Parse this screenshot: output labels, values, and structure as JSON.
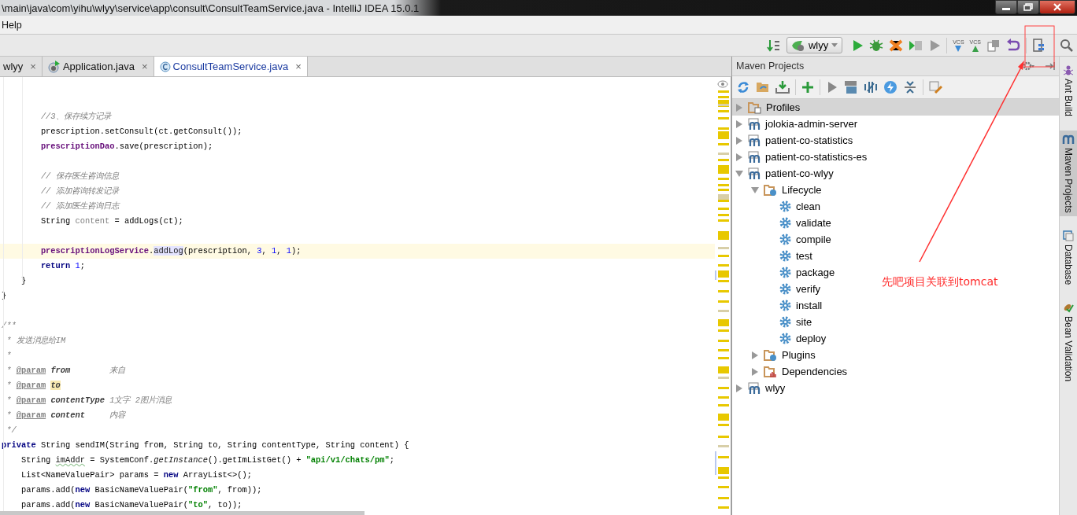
{
  "window": {
    "title": "\\main\\java\\com\\yihu\\wlyy\\service\\app\\consult\\ConsultTeamService.java - IntelliJ IDEA 15.0.1"
  },
  "menu": [
    "Help"
  ],
  "toolbar": {
    "run_config": "wlyy",
    "vcs_update": "VCS",
    "vcs_commit": "VCS"
  },
  "tabs": [
    {
      "label": "wlyy",
      "close": "×",
      "kind": "plain",
      "selected": false
    },
    {
      "label": "Application.java",
      "close": "×",
      "kind": "app",
      "selected": false
    },
    {
      "label": "ConsultTeamService.java",
      "close": "×",
      "kind": "class",
      "selected": true
    }
  ],
  "editor": {
    "lines": [
      {
        "kind": "blank"
      },
      {
        "kind": "blank"
      },
      {
        "kind": "code",
        "tokens": [
          {
            "kind": "comment",
            "text": "        //3、保存续方记录"
          }
        ]
      },
      {
        "kind": "code",
        "tokens": [
          {
            "kind": "plain",
            "text": "        prescription.setConsult(ct.getConsult());"
          }
        ]
      },
      {
        "kind": "code",
        "tokens": [
          {
            "kind": "field",
            "text": "        prescriptionDao"
          },
          {
            "kind": "plain",
            "text": ".save(prescription);"
          }
        ]
      },
      {
        "kind": "blank"
      },
      {
        "kind": "code",
        "tokens": [
          {
            "kind": "comment",
            "text": "        // 保存医生咨询信息"
          }
        ]
      },
      {
        "kind": "code",
        "tokens": [
          {
            "kind": "comment",
            "text": "        // 添加咨询转发记录"
          }
        ]
      },
      {
        "kind": "code",
        "tokens": [
          {
            "kind": "comment",
            "text": "        // 添加医生咨询日志"
          }
        ]
      },
      {
        "kind": "code",
        "tokens": [
          {
            "kind": "plain",
            "text": "        String "
          },
          {
            "kind": "unused",
            "text": "content"
          },
          {
            "kind": "plain",
            "text": " = addLogs(ct);"
          }
        ]
      },
      {
        "kind": "blank"
      },
      {
        "kind": "current",
        "tokens": [
          {
            "kind": "field",
            "text": "        prescriptionLogService"
          },
          {
            "kind": "plain",
            "text": "."
          },
          {
            "kind": "usage",
            "text": "addLog"
          },
          {
            "kind": "plain",
            "text": "(prescription, "
          },
          {
            "kind": "number",
            "text": "3"
          },
          {
            "kind": "plain",
            "text": ", "
          },
          {
            "kind": "number",
            "text": "1"
          },
          {
            "kind": "plain",
            "text": ", "
          },
          {
            "kind": "number",
            "text": "1"
          },
          {
            "kind": "plain",
            "text": ");"
          }
        ]
      },
      {
        "kind": "code",
        "tokens": [
          {
            "kind": "keyword",
            "text": "        return "
          },
          {
            "kind": "number",
            "text": "1"
          },
          {
            "kind": "plain",
            "text": ";"
          }
        ]
      },
      {
        "kind": "code",
        "tokens": [
          {
            "kind": "plain",
            "text": "    }"
          }
        ]
      },
      {
        "kind": "code",
        "tokens": [
          {
            "kind": "plain",
            "text": "}"
          }
        ]
      },
      {
        "kind": "blank"
      },
      {
        "kind": "code",
        "tokens": [
          {
            "kind": "doc",
            "text": "/**"
          }
        ]
      },
      {
        "kind": "code",
        "tokens": [
          {
            "kind": "doc",
            "text": " * 发送消息给IM"
          }
        ]
      },
      {
        "kind": "code",
        "tokens": [
          {
            "kind": "doc",
            "text": " *"
          }
        ]
      },
      {
        "kind": "code",
        "tokens": [
          {
            "kind": "doc",
            "text": " * "
          },
          {
            "kind": "doctag",
            "text": "@param"
          },
          {
            "kind": "docparam",
            "text": "from"
          },
          {
            "kind": "doc",
            "text": "        来自"
          }
        ]
      },
      {
        "kind": "code",
        "tokens": [
          {
            "kind": "doc",
            "text": " * "
          },
          {
            "kind": "doctag",
            "text": "@param"
          },
          {
            "kind": "docparam-marked",
            "text": "to"
          }
        ]
      },
      {
        "kind": "code",
        "tokens": [
          {
            "kind": "doc",
            "text": " * "
          },
          {
            "kind": "doctag",
            "text": "@param"
          },
          {
            "kind": "docparam",
            "text": "contentType"
          },
          {
            "kind": "doc",
            "text": " 1文字 2图片消息"
          }
        ]
      },
      {
        "kind": "code",
        "tokens": [
          {
            "kind": "doc",
            "text": " * "
          },
          {
            "kind": "doctag",
            "text": "@param"
          },
          {
            "kind": "docparam",
            "text": "content"
          },
          {
            "kind": "doc",
            "text": "     内容"
          }
        ]
      },
      {
        "kind": "code",
        "tokens": [
          {
            "kind": "doc",
            "text": " */"
          }
        ]
      },
      {
        "kind": "code",
        "tokens": [
          {
            "kind": "keyword",
            "text": "private"
          },
          {
            "kind": "plain",
            "text": " String sendIM(String from, String to, String contentType, String content) {"
          }
        ]
      },
      {
        "kind": "code",
        "tokens": [
          {
            "kind": "plain",
            "text": "    String "
          },
          {
            "kind": "warn",
            "text": "imAddr"
          },
          {
            "kind": "plain",
            "text": " = SystemConf."
          },
          {
            "kind": "static",
            "text": "getInstance"
          },
          {
            "kind": "plain",
            "text": "().getImListGet() + "
          },
          {
            "kind": "string",
            "text": "\"api/v1/chats/pm\""
          },
          {
            "kind": "plain",
            "text": ";"
          }
        ]
      },
      {
        "kind": "code",
        "tokens": [
          {
            "kind": "plain",
            "text": "    List<NameValuePair> params = "
          },
          {
            "kind": "keyword",
            "text": "new"
          },
          {
            "kind": "plain",
            "text": " ArrayList<>();"
          }
        ]
      },
      {
        "kind": "code",
        "tokens": [
          {
            "kind": "plain",
            "text": "    params.add("
          },
          {
            "kind": "keyword",
            "text": "new"
          },
          {
            "kind": "plain",
            "text": " BasicNameValuePair("
          },
          {
            "kind": "string",
            "text": "\"from\""
          },
          {
            "kind": "plain",
            "text": ", from));"
          }
        ]
      },
      {
        "kind": "code",
        "tokens": [
          {
            "kind": "plain",
            "text": "    params.add("
          },
          {
            "kind": "keyword",
            "text": "new"
          },
          {
            "kind": "plain",
            "text": " BasicNameValuePair("
          },
          {
            "kind": "string",
            "text": "\"to\""
          },
          {
            "kind": "plain",
            "text": ", to));"
          }
        ]
      }
    ]
  },
  "maven": {
    "title": "Maven Projects",
    "tree": [
      {
        "label": "Profiles",
        "kind": "profiles",
        "expanded": false,
        "selected": true
      },
      {
        "label": "jolokia-admin-server",
        "kind": "module",
        "expanded": false,
        "selected": false
      },
      {
        "label": "patient-co-statistics",
        "kind": "module",
        "expanded": false,
        "selected": false
      },
      {
        "label": "patient-co-statistics-es",
        "kind": "module",
        "expanded": false,
        "selected": false
      },
      {
        "label": "patient-co-wlyy",
        "kind": "module",
        "expanded": true,
        "selected": false,
        "children": [
          {
            "label": "Lifecycle",
            "kind": "lifecycle",
            "expanded": true,
            "selected": false,
            "children": [
              {
                "label": "clean",
                "kind": "goal",
                "selected": false
              },
              {
                "label": "validate",
                "kind": "goal",
                "selected": false
              },
              {
                "label": "compile",
                "kind": "goal",
                "selected": false
              },
              {
                "label": "test",
                "kind": "goal",
                "selected": false
              },
              {
                "label": "package",
                "kind": "goal",
                "selected": false
              },
              {
                "label": "verify",
                "kind": "goal",
                "selected": false
              },
              {
                "label": "install",
                "kind": "goal",
                "selected": false
              },
              {
                "label": "site",
                "kind": "goal",
                "selected": false
              },
              {
                "label": "deploy",
                "kind": "goal",
                "selected": false
              }
            ]
          },
          {
            "label": "Plugins",
            "kind": "plugins",
            "expanded": false,
            "selected": false
          },
          {
            "label": "Dependencies",
            "kind": "dependencies",
            "expanded": false,
            "selected": false
          }
        ]
      },
      {
        "label": "wlyy",
        "kind": "module",
        "expanded": false,
        "selected": false
      }
    ]
  },
  "side_tabs": [
    {
      "label": "Ant Build",
      "kind": "ant",
      "selected": false
    },
    {
      "label": "Maven Projects",
      "kind": "maven",
      "selected": true
    },
    {
      "label": "Database",
      "kind": "database",
      "selected": false
    },
    {
      "label": "Bean Validation",
      "kind": "bean",
      "selected": false
    }
  ],
  "annotation": {
    "text": "先吧项目关联到tomcat"
  }
}
